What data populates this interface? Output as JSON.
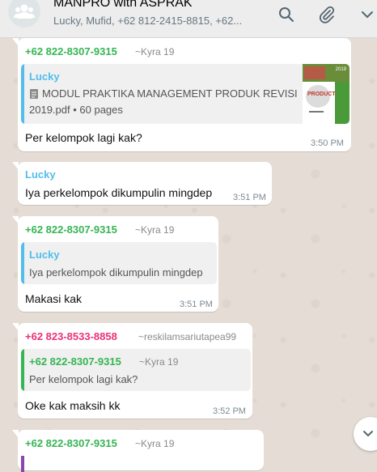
{
  "header": {
    "title": "MANPRO with ASPRAK",
    "participants": "Lucky, Mufid, +62 812-2415-8815, +62..."
  },
  "colors": {
    "green_sender": "#35b553",
    "lucky_blue": "#53bdeb",
    "pink_sender": "#e8327a"
  },
  "messages": [
    {
      "sender": "+62 822-8307-9315",
      "sender_alt": "~Kyra 19",
      "quote": {
        "name": "Lucky",
        "doc_title": "MODUL PRAKTIKA MANAGEMENT PRODUK REVISI",
        "doc_meta_file": "2019.pdf",
        "doc_meta_pages": "60 pages"
      },
      "text": "Per kelompok lagi kak?",
      "time": "3:50 PM"
    },
    {
      "sender": "Lucky",
      "text": "Iya perkelompok dikumpulin mingdep",
      "time": "3:51 PM"
    },
    {
      "sender": "+62 822-8307-9315",
      "sender_alt": "~Kyra 19",
      "quote": {
        "name": "Lucky",
        "text": "Iya perkelompok dikumpulin mingdep"
      },
      "text": "Makasi kak",
      "time": "3:51 PM"
    },
    {
      "sender": "+62 823-8533-8858",
      "sender_alt": "~reskilamsariutapea99",
      "quote": {
        "name": "+62 822-8307-9315",
        "name_alt": "~Kyra 19",
        "text": "Per kelompok lagi kak?"
      },
      "text": "Oke kak maksih kk",
      "time": "3:52 PM"
    },
    {
      "sender": "+62 822-8307-9315",
      "sender_alt": "~Kyra 19"
    }
  ],
  "thumbnail": {
    "tag": "2019",
    "word": "PRODUCT"
  }
}
